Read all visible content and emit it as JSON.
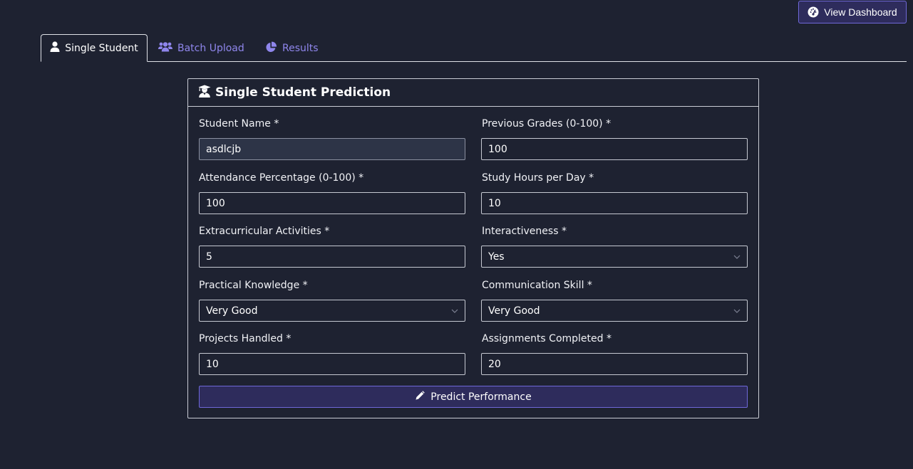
{
  "header": {
    "dashboard_button": "View Dashboard",
    "dashboard_icon": "gauge-icon"
  },
  "tabs": [
    {
      "label": "Single Student",
      "icon": "user-icon",
      "active": true
    },
    {
      "label": "Batch Upload",
      "icon": "users-icon",
      "active": false
    },
    {
      "label": "Results",
      "icon": "pie-chart-icon",
      "active": false
    }
  ],
  "card": {
    "title": "Single Student Prediction",
    "icon": "graduate-icon"
  },
  "fields": [
    {
      "label": "Student Name *",
      "value": "asdlcjb",
      "type": "text"
    },
    {
      "label": "Previous Grades (0-100) *",
      "value": "100",
      "type": "number"
    },
    {
      "label": "Attendance Percentage (0-100) *",
      "value": "100",
      "type": "number"
    },
    {
      "label": "Study Hours per Day *",
      "value": "10",
      "type": "number"
    },
    {
      "label": "Extracurricular Activities *",
      "value": "5",
      "type": "number"
    },
    {
      "label": "Interactiveness *",
      "value": "Yes",
      "type": "select"
    },
    {
      "label": "Practical Knowledge *",
      "value": "Very Good",
      "type": "select"
    },
    {
      "label": "Communication Skill *",
      "value": "Very Good",
      "type": "select"
    },
    {
      "label": "Projects Handled *",
      "value": "10",
      "type": "number"
    },
    {
      "label": "Assignments Completed *",
      "value": "20",
      "type": "number"
    }
  ],
  "predict_button": {
    "label": "Predict Performance",
    "icon": "pencil-icon"
  },
  "colors": {
    "background": "#1e2231",
    "accent": "#6f68d8",
    "button_fill": "#2e2c5c",
    "link": "#8f86ec"
  }
}
